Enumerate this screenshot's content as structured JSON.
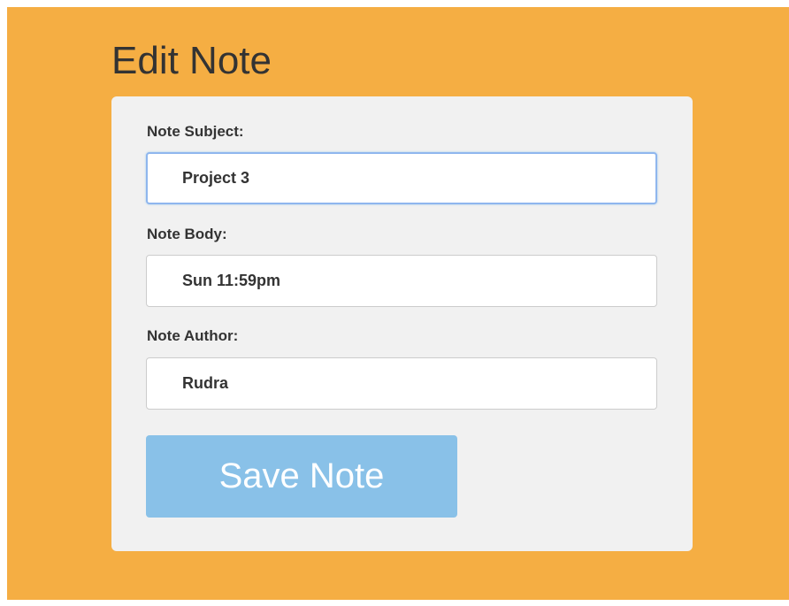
{
  "page": {
    "title": "Edit Note",
    "background_color": "#f5ae43",
    "card_color": "#f1f1f1"
  },
  "form": {
    "subject": {
      "label": "Note Subject:",
      "value": "Project 3",
      "focused": true
    },
    "body": {
      "label": "Note Body:",
      "value": "Sun 11:59pm"
    },
    "author": {
      "label": "Note Author:",
      "value": "Rudra"
    },
    "save_button": {
      "label": "Save Note",
      "color": "#89c1e8"
    }
  }
}
